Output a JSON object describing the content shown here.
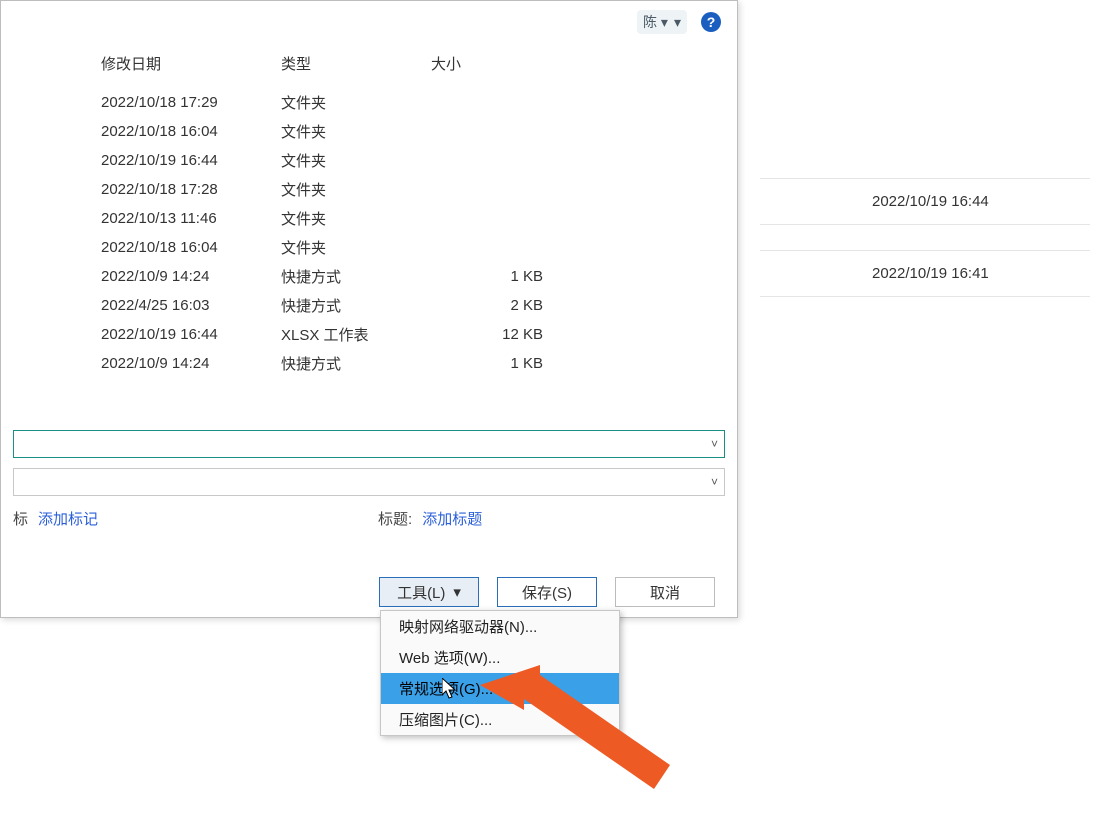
{
  "toolbar": {
    "view_label": "陈 ▾",
    "help_glyph": "?"
  },
  "columns": {
    "modified": "修改日期",
    "type": "类型",
    "size": "大小"
  },
  "rows": [
    {
      "modified": "2022/10/18 17:29",
      "type": "文件夹",
      "size": ""
    },
    {
      "modified": "2022/10/18 16:04",
      "type": "文件夹",
      "size": ""
    },
    {
      "modified": "2022/10/19 16:44",
      "type": "文件夹",
      "size": ""
    },
    {
      "modified": "2022/10/18 17:28",
      "type": "文件夹",
      "size": ""
    },
    {
      "modified": "2022/10/13 11:46",
      "type": "文件夹",
      "size": ""
    },
    {
      "modified": "2022/10/18 16:04",
      "type": "文件夹",
      "size": ""
    },
    {
      "modified": "2022/10/9 14:24",
      "type": "快捷方式",
      "size": "1 KB"
    },
    {
      "modified": "2022/4/25 16:03",
      "type": "快捷方式",
      "size": "2 KB"
    },
    {
      "modified": "2022/10/19 16:44",
      "type": "XLSX 工作表",
      "size": "12 KB"
    },
    {
      "modified": "2022/10/9 14:24",
      "type": "快捷方式",
      "size": "1 KB"
    }
  ],
  "meta": {
    "tag_label": "标",
    "tag_link": "添加标记",
    "title_label": "标题:",
    "title_link": "添加标题"
  },
  "buttons": {
    "tools": "工具(L)",
    "save": "保存(S)",
    "cancel": "取消"
  },
  "tools_menu": {
    "map_drive": "映射网络驱动器(N)...",
    "web_options": "Web 选项(W)...",
    "general_options": "常规选项(G)...",
    "compress_pictures": "压缩图片(C)..."
  },
  "background": {
    "row1_date": "2022/10/19 16:44",
    "row2_date": "2022/10/19 16:41"
  }
}
